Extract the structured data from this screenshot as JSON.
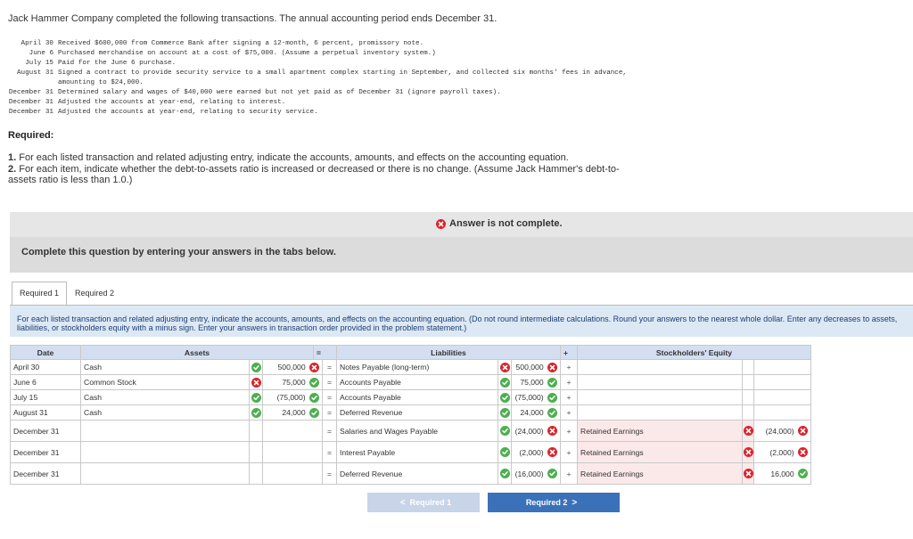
{
  "intro": "Jack Hammer Company completed the following transactions. The annual accounting period ends December 31.",
  "transactions": [
    {
      "date": "April 30",
      "text": "Received $600,000 from Commerce Bank after signing a 12-month, 6 percent, promissory note."
    },
    {
      "date": "June 6",
      "text": "Purchased merchandise on account at a cost of $75,000. (Assume a perpetual inventory system.)"
    },
    {
      "date": "July 15",
      "text": "Paid for the June 6 purchase."
    },
    {
      "date": "August 31",
      "text": "Signed a contract to provide security service to a small apartment complex starting in September, and collected six months' fees in advance, amounting to $24,000."
    },
    {
      "date": "December 31",
      "text": "Determined salary and wages of $40,000 were earned but not yet paid as of December 31 (ignore payroll taxes)."
    },
    {
      "date": "December 31",
      "text": "Adjusted the accounts at year-end, relating to interest."
    },
    {
      "date": "December 31",
      "text": "Adjusted the accounts at year-end, relating to security service."
    }
  ],
  "required_heading": "Required:",
  "required_items": [
    {
      "num": "1.",
      "text": "For each listed transaction and related adjusting entry, indicate the accounts, amounts, and effects on the accounting equation."
    },
    {
      "num": "2.",
      "text": "For each item, indicate whether the debt-to-assets ratio is increased or decreased or there is no change. (Assume Jack Hammer's debt-to-assets ratio is less than 1.0.)"
    }
  ],
  "answer_status": "Answer is not complete.",
  "complete_prompt": "Complete this question by entering your answers in the tabs below.",
  "tabs": [
    "Required 1",
    "Required 2"
  ],
  "instructions": "For each listed transaction and related adjusting entry, indicate the accounts, amounts, and effects on the accounting equation. (Do not round intermediate calculations. Round your answers to the nearest whole dollar. Enter any decreases to assets, liabilities, or stockholders equity with a minus sign. Enter your answers in transaction order provided in the problem statement.)",
  "table": {
    "headers": {
      "date": "Date",
      "assets": "Assets",
      "eq": "=",
      "liabilities": "Liabilities",
      "plus": "+",
      "equity": "Stockholders' Equity"
    },
    "rows": [
      {
        "date": "April 30",
        "asset": "Cash",
        "asset_mark": "ok",
        "asset_amt": "500,000",
        "asset_amt_mark": "bad",
        "eq": "=",
        "liab": "Notes Payable (long-term)",
        "liab_mark": "bad",
        "liab_amt": "500,000",
        "liab_amt_mark": "bad",
        "plus": "+",
        "se": "",
        "se_mark": "",
        "se_amt": "",
        "se_amt_mark": ""
      },
      {
        "date": "June 6",
        "asset": "Common Stock",
        "asset_mark": "bad",
        "asset_amt": "75,000",
        "asset_amt_mark": "ok",
        "eq": "=",
        "liab": "Accounts Payable",
        "liab_mark": "ok",
        "liab_amt": "75,000",
        "liab_amt_mark": "ok",
        "plus": "+",
        "se": "",
        "se_mark": "",
        "se_amt": "",
        "se_amt_mark": ""
      },
      {
        "date": "July 15",
        "asset": "Cash",
        "asset_mark": "ok",
        "asset_amt": "(75,000)",
        "asset_amt_mark": "ok",
        "eq": "=",
        "liab": "Accounts Payable",
        "liab_mark": "ok",
        "liab_amt": "(75,000)",
        "liab_amt_mark": "ok",
        "plus": "+",
        "se": "",
        "se_mark": "",
        "se_amt": "",
        "se_amt_mark": ""
      },
      {
        "date": "August 31",
        "asset": "Cash",
        "asset_mark": "ok",
        "asset_amt": "24,000",
        "asset_amt_mark": "ok",
        "eq": "=",
        "liab": "Deferred Revenue",
        "liab_mark": "ok",
        "liab_amt": "24,000",
        "liab_amt_mark": "ok",
        "plus": "+",
        "se": "",
        "se_mark": "",
        "se_amt": "",
        "se_amt_mark": ""
      },
      {
        "date": "December 31",
        "asset": "",
        "asset_mark": "",
        "asset_amt": "",
        "asset_amt_mark": "",
        "eq": "=",
        "liab": "Salaries and Wages Payable",
        "liab_mark": "ok",
        "liab_amt": "(24,000)",
        "liab_amt_mark": "bad",
        "plus": "+",
        "se": "Retained Earnings",
        "se_mark": "bad",
        "se_amt": "(24,000)",
        "se_amt_mark": "bad"
      },
      {
        "date": "December 31",
        "asset": "",
        "asset_mark": "",
        "asset_amt": "",
        "asset_amt_mark": "",
        "eq": "=",
        "liab": "Interest Payable",
        "liab_mark": "ok",
        "liab_amt": "(2,000)",
        "liab_amt_mark": "bad",
        "plus": "+",
        "se": "Retained Earnings",
        "se_mark": "bad",
        "se_amt": "(2,000)",
        "se_amt_mark": "bad"
      },
      {
        "date": "December 31",
        "asset": "",
        "asset_mark": "",
        "asset_amt": "",
        "asset_amt_mark": "",
        "eq": "=",
        "liab": "Deferred Revenue",
        "liab_mark": "ok",
        "liab_amt": "(16,000)",
        "liab_amt_mark": "ok",
        "plus": "+",
        "se": "Retained Earnings",
        "se_mark": "bad",
        "se_amt": "16,000",
        "se_amt_mark": "ok"
      }
    ]
  },
  "nav": {
    "prev_label": "Required 1",
    "next_label": "Required 2",
    "prev_chevron": "<",
    "next_chevron": ">"
  },
  "colors": {
    "correct": "#4caf50",
    "incorrect": "#d9242b",
    "accent": "#3b71b8",
    "header_bg": "#d3dff0"
  }
}
